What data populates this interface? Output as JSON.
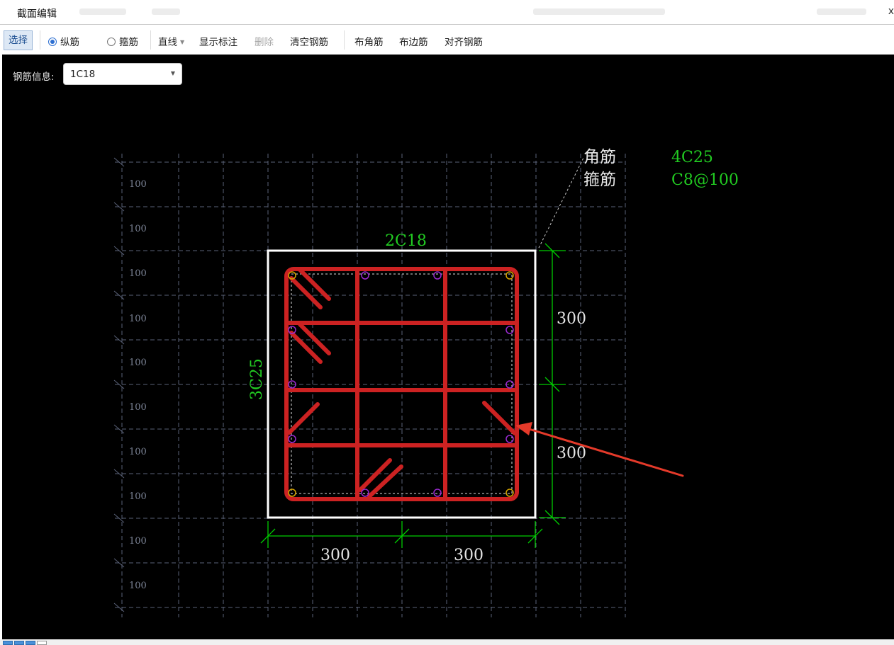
{
  "window": {
    "title": "截面编辑",
    "close_glyph": "x"
  },
  "toolbar": {
    "select": "选择",
    "longitudinal": "纵筋",
    "stirrup": "箍筋",
    "line_mode": "直线",
    "show_annotation": "显示标注",
    "delete": "删除",
    "clear_rebar": "清空钢筋",
    "place_corner": "布角筋",
    "place_edge": "布边筋",
    "align_rebar": "对齐钢筋",
    "selected_mode": "longitudinal"
  },
  "rebar_info": {
    "label": "钢筋信息:",
    "value": "1C18"
  },
  "drawing": {
    "grid_labels": [
      "100",
      "100",
      "100",
      "100",
      "100",
      "100",
      "100",
      "100",
      "100",
      "100"
    ],
    "top_label": "2C18",
    "left_label": "3C25",
    "corner_rebar_label": "角筋",
    "corner_rebar_value": "4C25",
    "stirrup_label": "箍筋",
    "stirrup_value": "C8@100",
    "dim_right_top": "300",
    "dim_right_bottom": "300",
    "dim_bottom_left": "300",
    "dim_bottom_right": "300",
    "colors": {
      "background": "#000000",
      "grid": "#5a6278",
      "section": "#ffffff",
      "stirrup": "#cc2222",
      "dimension": "#00cc00",
      "label_green": "#22cc22",
      "text_white": "#e6e6e6",
      "arrow": "#e53a2a",
      "corner_bar": "#d4a400",
      "edge_bar": "#9a2ad0"
    }
  }
}
